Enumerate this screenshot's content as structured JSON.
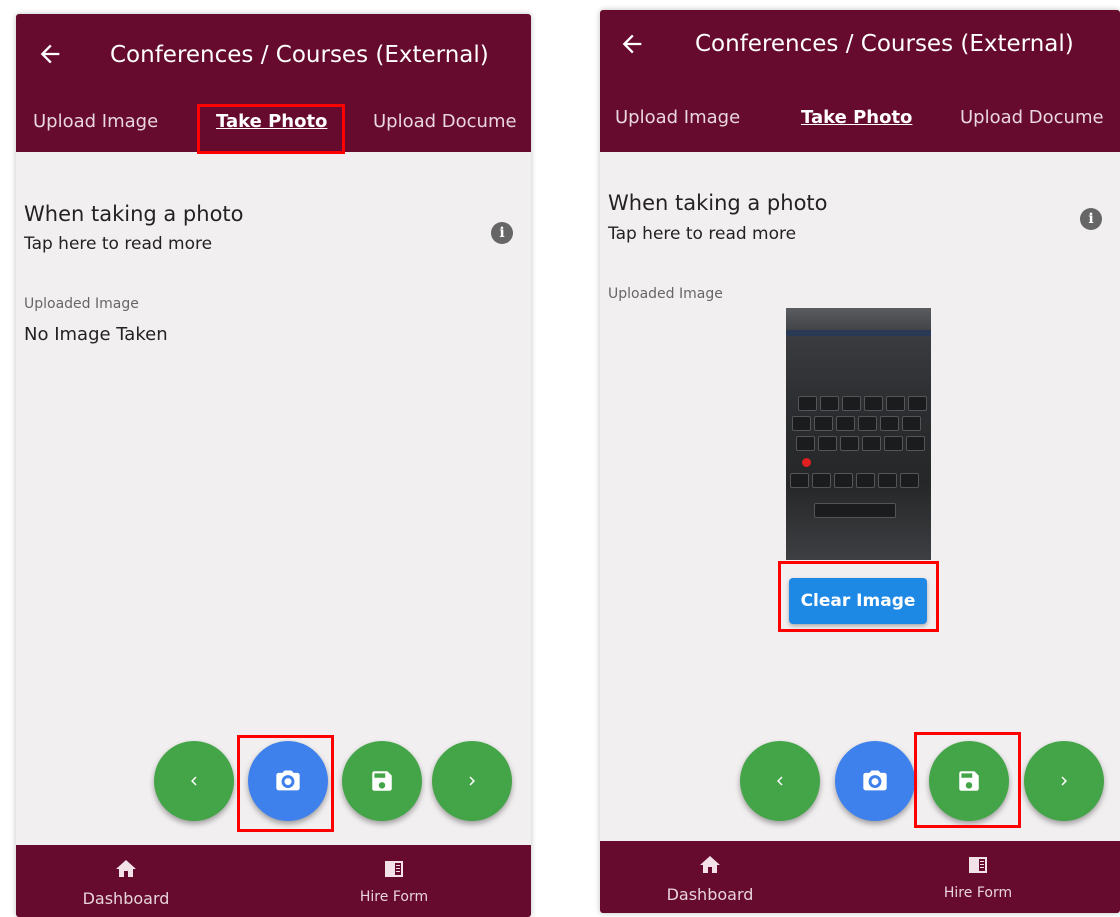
{
  "colors": {
    "appbar": "#660b2d",
    "fab_green": "#43a547",
    "fab_blue": "#3f81ec",
    "clear_button": "#1e88e5",
    "highlight": "#ff0000"
  },
  "screens": [
    {
      "title": "Conferences / Courses (External)",
      "tabs": [
        "Upload Image",
        "Take Photo",
        "Upload Docume"
      ],
      "active_tab": "Take Photo",
      "info_title": "When taking a photo",
      "info_subtitle": "Tap here to read more",
      "uploaded_label": "Uploaded Image",
      "no_image_text": "No Image Taken",
      "fabs": [
        "chevron-left-icon",
        "camera-icon",
        "save-icon",
        "chevron-right-icon"
      ],
      "highlighted": [
        "tab-take-photo",
        "camera-button"
      ],
      "nav": [
        "Dashboard",
        "Hire Form"
      ]
    },
    {
      "title": "Conferences / Courses (External)",
      "tabs": [
        "Upload Image",
        "Take Photo",
        "Upload Docume"
      ],
      "active_tab": "Take Photo",
      "info_title": "When taking a photo",
      "info_subtitle": "Tap here to read more",
      "uploaded_label": "Uploaded Image",
      "clear_image_label": "Clear Image",
      "fabs": [
        "chevron-left-icon",
        "camera-icon",
        "save-icon",
        "chevron-right-icon"
      ],
      "highlighted": [
        "clear-image-button",
        "save-button"
      ],
      "nav": [
        "Dashboard",
        "Hire Form"
      ]
    }
  ]
}
